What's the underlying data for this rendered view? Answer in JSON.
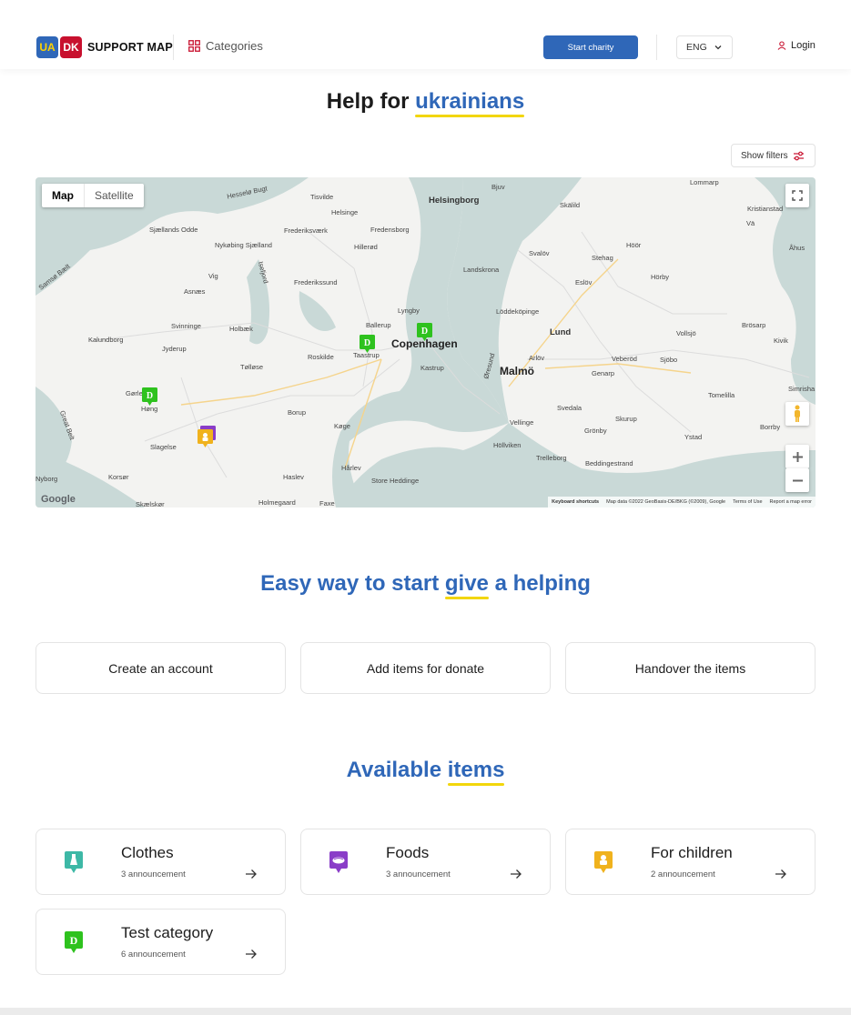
{
  "header": {
    "logo": {
      "ua": "UA",
      "dk": "DK",
      "name": "SUPPORT MAP"
    },
    "categories_label": "Categories",
    "start_charity_label": "Start charity",
    "language": "ENG",
    "login_label": "Login"
  },
  "hero": {
    "title_prefix": "Help for",
    "title_highlight": "ukrainians"
  },
  "filters": {
    "label": "Show filters"
  },
  "map": {
    "toggle": {
      "map": "Map",
      "satellite": "Satellite"
    },
    "labels": {
      "copenhagen": "Copenhagen",
      "malmo": "Malmö",
      "lund": "Lund",
      "helsingborg": "Helsingborg",
      "hillerod": "Hillerød",
      "roskilde": "Roskilde",
      "kastrup": "Kastrup",
      "taastrup": "Taastrup",
      "ballerup": "Ballerup",
      "lyngby": "Lyngby",
      "koge": "Køge",
      "slagelse": "Slagelse",
      "holbaek": "Holbæk",
      "kalundborg": "Kalundborg",
      "trelleborg": "Trelleborg",
      "ystad": "Ystad",
      "landskrona": "Landskrona",
      "eslov": "Eslöv",
      "horby": "Hörby",
      "sjobo": "Sjöbo",
      "svedala": "Svedala",
      "vellinge": "Vellinge",
      "skurup": "Skurup",
      "hollviken": "Höllviken",
      "store_heddinge": "Store Heddinge",
      "haslev": "Haslev",
      "faxe": "Faxe",
      "borup": "Borup",
      "frederikssund": "Frederikssund",
      "frederiksvaerk": "Frederiksværk",
      "fredensborg": "Fredensborg",
      "helsinge": "Helsinge",
      "tisvilde": "Tisvilde",
      "sjaellands_odde": "Sjællands Odde",
      "nykobing": "Nykøbing Sjælland",
      "asnaes": "Asnæs",
      "vig": "Vig",
      "svinninge": "Svinninge",
      "jyderup": "Jyderup",
      "tollose": "Tølløse",
      "gorlev": "Gørlev",
      "hong": "Høng",
      "korsor": "Korsør",
      "skaelskor": "Skælskør",
      "holmegaard": "Holmegaard",
      "harlev": "Hårlev",
      "lommarp": "Lommarp",
      "bjuv": "Bjuv",
      "skalild": "Skälild",
      "kristianstad": "Kristianstad",
      "va": "Vä",
      "ahus": "Åhus",
      "hoor": "Höör",
      "stehag": "Stehag",
      "svalov": "Svalöv",
      "loddekopinge": "Löddeköpinge",
      "vollsjo": "Vollsjö",
      "brosarp": "Brösarp",
      "kivik": "Kivik",
      "simrishamn": "Simrisha",
      "tomelilla": "Tomelilla",
      "borrby": "Borrby",
      "arlov": "Arlöv",
      "veberod": "Veberöd",
      "genarp": "Genarp",
      "gronby": "Grönby",
      "beddingestrand": "Beddingestrand",
      "hesselo_bugt": "Hesselø Bugt",
      "samso_baelt": "Samsø Bælt",
      "great_belt": "Great Belt",
      "oresund": "Øresund",
      "isefjord": "Isefjord",
      "nyborg": "Nyborg"
    },
    "google": "Google",
    "attribution": {
      "shortcuts": "Keyboard shortcuts",
      "data": "Map data ©2022 GeoBasis-DE/BKG (©2009), Google",
      "terms": "Terms of Use",
      "report": "Report a map error"
    }
  },
  "steps": {
    "title_prefix": "Easy way to start",
    "title_highlight": "give",
    "title_suffix": "a helping",
    "items": [
      "Create an account",
      "Add items for donate",
      "Handover the items"
    ]
  },
  "available": {
    "title_prefix": "Available",
    "title_highlight": "items",
    "items": [
      {
        "name": "Clothes",
        "count": "3 announcement",
        "icon": "dress-icon",
        "color": "#3db8a6"
      },
      {
        "name": "Foods",
        "count": "3 announcement",
        "icon": "food-icon",
        "color": "#8a3dc8"
      },
      {
        "name": "For children",
        "count": "2 announcement",
        "icon": "toy-icon",
        "color": "#f0b21d"
      },
      {
        "name": "Test category",
        "count": "6 announcement",
        "icon": "letter-d-icon",
        "color": "#2ec21e"
      }
    ]
  },
  "colors": {
    "brand_blue": "#2f67b8",
    "highlight_yellow": "#f2d60b",
    "dk_red": "#c8102e"
  }
}
